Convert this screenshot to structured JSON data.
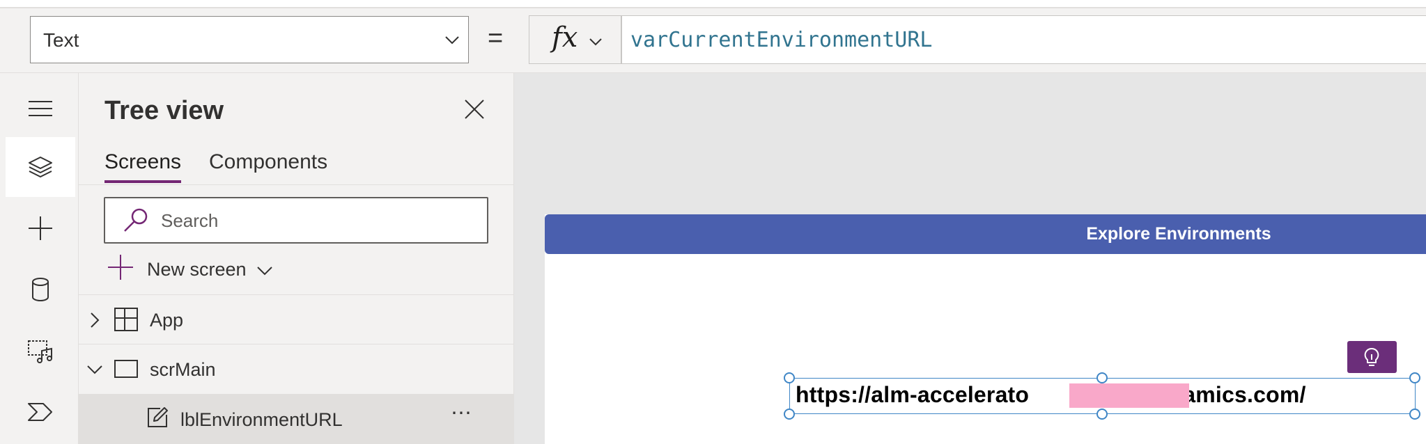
{
  "formula_bar": {
    "property_value": "Text",
    "equals": "=",
    "fx_label": "fx",
    "formula": "varCurrentEnvironmentURL"
  },
  "rail": {
    "items": [
      {
        "icon": "hamburger-menu-icon"
      },
      {
        "icon": "layers-icon",
        "active": true
      },
      {
        "icon": "plus-icon"
      },
      {
        "icon": "database-icon"
      },
      {
        "icon": "media-icon"
      },
      {
        "icon": "power-automate-icon"
      }
    ]
  },
  "tree_view": {
    "title": "Tree view",
    "tabs": [
      {
        "label": "Screens",
        "active": true
      },
      {
        "label": "Components",
        "active": false
      }
    ],
    "search_placeholder": "Search",
    "new_screen_label": "New screen",
    "items": [
      {
        "label": "App",
        "icon": "app-icon",
        "expanded": false
      },
      {
        "label": "scrMain",
        "icon": "screen-icon",
        "expanded": true
      },
      {
        "label": "lblEnvironmentURL",
        "icon": "edit-label-icon",
        "selected": true,
        "more": "⋯"
      }
    ]
  },
  "canvas": {
    "header_title": "Explore Environments",
    "url_label": "https://alm-accelerato                 .dynamics.com/",
    "idea_button_icon": "lightbulb-icon"
  },
  "colors": {
    "header": "#4a5fae",
    "accent_purple": "#742774",
    "formula_text": "#31748f",
    "selection": "#3f86c6"
  }
}
